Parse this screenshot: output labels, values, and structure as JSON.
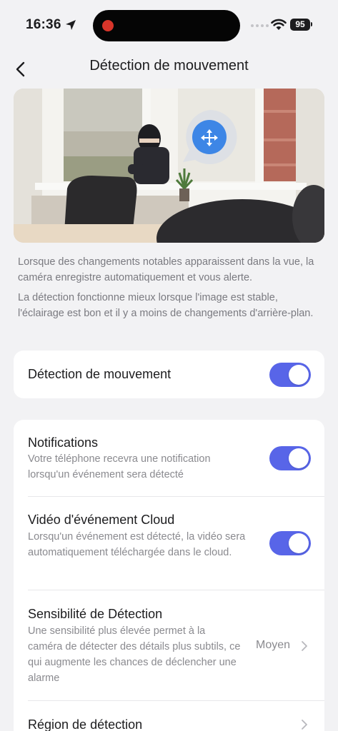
{
  "status_bar": {
    "time": "16:36",
    "battery": "95"
  },
  "nav": {
    "title": "Détection de mouvement"
  },
  "description": {
    "line1": "Lorsque des changements notables apparaissent dans la vue, la caméra enregistre automatiquement et vous alerte.",
    "line2": "La détection fonctionne mieux lorsque l'image est stable, l'éclairage est bon et il y a moins de changements d'arrière-plan."
  },
  "motion_detection": {
    "label": "Détection de mouvement",
    "enabled": true
  },
  "settings": {
    "notifications": {
      "title": "Notifications",
      "subtitle": "Votre téléphone recevra une notification lorsqu'un événement sera détecté",
      "enabled": true
    },
    "cloud_video": {
      "title": "Vidéo d'événement Cloud",
      "subtitle": "Lorsqu'un événement est détecté, la vidéo sera automatiquement téléchargée dans le cloud.",
      "enabled": true
    },
    "sensitivity": {
      "title": "Sensibilité de Détection",
      "subtitle": "Une sensibilité plus élevée permet à la caméra de détecter des détails plus subtils, ce qui augmente les chances de déclencher une alarme",
      "value": "Moyen"
    },
    "region": {
      "title": "Région de détection"
    }
  },
  "colors": {
    "accent": "#5865e8",
    "background": "#f2f2f4",
    "card": "#ffffff",
    "secondary_text": "#8a8a8f",
    "recording_dot": "#d8352a"
  },
  "icons": [
    "location-arrow-icon",
    "wifi-icon",
    "back-chevron-icon",
    "move-icon",
    "chevron-right-icon"
  ]
}
